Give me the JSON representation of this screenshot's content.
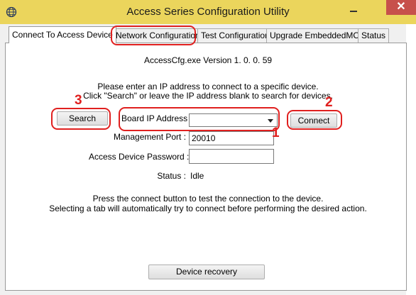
{
  "window": {
    "title": "Access Series Configuration Utility",
    "close_symbol": "✕",
    "app_icon": "globe-icon",
    "title_bar_color": "#ebd55c",
    "close_button_color": "#c7504b"
  },
  "tabs": [
    {
      "label": "Connect To Access Device",
      "active": true
    },
    {
      "label": "Network Configuration",
      "active": false
    },
    {
      "label": "Test Configuration",
      "active": false
    },
    {
      "label": "Upgrade EmbeddedMCS",
      "active": false
    },
    {
      "label": "Status",
      "active": false
    }
  ],
  "main": {
    "version_text": "AccessCfg.exe Version 1. 0. 0. 59",
    "instruction_line1": "Please enter an IP address to connect to a specific device.",
    "instruction_line2": "Click \"Search\" or leave the IP address blank to search for devices.",
    "search_button": "Search",
    "connect_button": "Connect",
    "board_ip_label": "Board IP Address :",
    "board_ip_value": "",
    "management_port_label": "Management Port :",
    "management_port_value": "20010",
    "password_label": "Access Device Password :",
    "password_value": "",
    "status_label": "Status :",
    "status_value": "Idle",
    "footer_line1": "Press the connect button to test the connection to the device.",
    "footer_line2": "Selecting a tab will automatically try to connect before performing the desired action.",
    "recovery_button": "Device recovery"
  },
  "annotations": {
    "color": "#e0201f",
    "label_1": "1",
    "label_2": "2",
    "label_3": "3"
  }
}
